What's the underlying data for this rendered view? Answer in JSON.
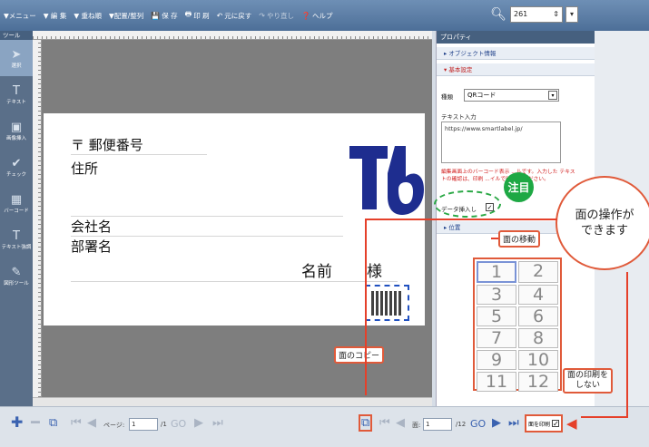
{
  "toolbar": {
    "items": [
      "▼メニュー",
      "▼ 編 集",
      "▼ 重ね順",
      "▼配置/整列",
      "保 存",
      "印 刷",
      "元に戻す",
      "やり直し",
      "ヘルプ"
    ],
    "zoom_value": "261"
  },
  "tools": {
    "header": "ツール",
    "items": [
      "選択",
      "テキスト",
      "画像挿入",
      "チェック",
      "バーコード",
      "テキスト強調",
      "図形ツール"
    ]
  },
  "paper": {
    "postal": "〒 郵便番号",
    "address": "住所",
    "company": "会社名",
    "dept": "部署名",
    "name": "名前",
    "sama": "様"
  },
  "props": {
    "title": "プロパティ",
    "object_info": "▸ オブジェクト情報",
    "basic": "▾ 基本設定",
    "type_label": "種類",
    "type_value": "QRコード",
    "text_label": "テキスト入力",
    "text_value": "https://www.smartlabel.jp/",
    "warning": "編集画面上のバーコード表示 ...ルです。入力した テキストの確認は、印刷 ...イルで行ってく ださい。",
    "data_join": "データ挿入し",
    "position": "▸ 位置",
    "faces": [
      "1",
      "2",
      "3",
      "4",
      "5",
      "6",
      "7",
      "8",
      "9",
      "10",
      "11",
      "12"
    ]
  },
  "bottom": {
    "page_label": "ページ:",
    "page_value": "1",
    "page_total": "/1",
    "go": "GO",
    "face_label": "面:",
    "face_value": "1",
    "face_total": "/12",
    "face_print": "面を印刷"
  },
  "annotations": {
    "chui": "注目",
    "face_ops": "面の操作が\nできます",
    "face_move": "面の移動",
    "face_copy": "面のコピー",
    "no_print": "面の印刷を\nしない"
  },
  "colors": {
    "accent": "#e05a3a",
    "toolbar": "#5a7aa6",
    "green": "#1ea844"
  }
}
